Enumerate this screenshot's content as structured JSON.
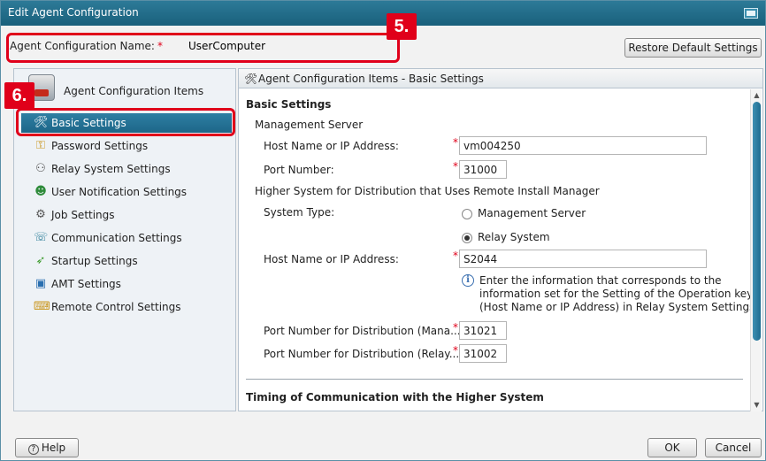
{
  "window": {
    "title": "Edit Agent Configuration"
  },
  "callouts": {
    "five": "5.",
    "six": "6."
  },
  "name_row": {
    "label": "Agent Configuration Name:",
    "required_mark": "*",
    "value": "UserComputer"
  },
  "buttons": {
    "restore": "Restore Default Settings",
    "help": "Help",
    "ok": "OK",
    "cancel": "Cancel"
  },
  "sidebar": {
    "header": "Agent Configuration Items",
    "items": [
      {
        "label": "Basic Settings",
        "icon": "tools-icon",
        "active": true
      },
      {
        "label": "Password Settings",
        "icon": "key-icon"
      },
      {
        "label": "Relay System Settings",
        "icon": "network-icon"
      },
      {
        "label": "User Notification Settings",
        "icon": "user-notify-icon"
      },
      {
        "label": "Job Settings",
        "icon": "job-icon"
      },
      {
        "label": "Communication Settings",
        "icon": "communication-icon"
      },
      {
        "label": "Startup Settings",
        "icon": "startup-icon"
      },
      {
        "label": "AMT Settings",
        "icon": "amt-icon"
      },
      {
        "label": "Remote Control Settings",
        "icon": "remote-control-icon"
      }
    ]
  },
  "main": {
    "header": "Agent Configuration Items - Basic Settings",
    "section_title": "Basic Settings",
    "management_server": "Management Server",
    "host_label": "Host Name or IP Address:",
    "host_value": "vm004250",
    "port_label": "Port Number:",
    "port_value": "31000",
    "higher_system": "Higher System for Distribution that Uses Remote Install Manager",
    "system_type_label": "System Type:",
    "radio_management": "Management Server",
    "radio_relay": "Relay System",
    "host2_label": "Host Name or IP Address:",
    "host2_value": "S2044",
    "info_text": [
      "Enter the information that corresponds to the",
      "information set for the Setting of the Operation key",
      "(Host Name or IP Address) in Relay System Settings."
    ],
    "port_dist_mana_label": "Port Number for Distribution (Mana...",
    "port_dist_mana_value": "31021",
    "port_dist_relay_label": "Port Number for Distribution (Relay...",
    "port_dist_relay_value": "31002",
    "timing_title": "Timing of Communication with the Higher System"
  },
  "colors": {
    "accent": "#1d6688",
    "callout": "#e0001a"
  }
}
